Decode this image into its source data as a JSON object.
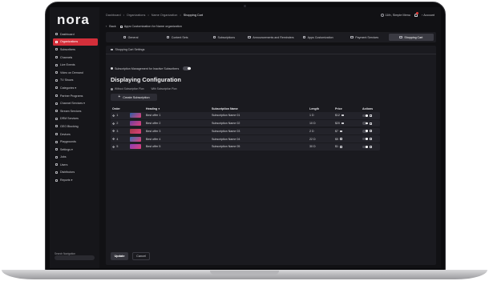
{
  "brand": {
    "logo_text": "nora"
  },
  "sidebar": {
    "items": [
      {
        "label": "Dashboard",
        "active": false
      },
      {
        "label": "Organizations",
        "active": true
      },
      {
        "label": "Subscribers",
        "active": false
      },
      {
        "label": "Channels",
        "active": false
      },
      {
        "label": "Live Events",
        "active": false
      },
      {
        "label": "Video on Demand",
        "active": false
      },
      {
        "label": "TV Shows",
        "active": false
      },
      {
        "label": "Categories ▾",
        "active": false
      },
      {
        "label": "Partner Programs",
        "active": false
      },
      {
        "label": "Channel Services ▾",
        "active": false
      },
      {
        "label": "Stream Services",
        "active": false
      },
      {
        "label": "DRM Services",
        "active": false
      },
      {
        "label": "GEO Blocking",
        "active": false
      },
      {
        "label": "Devices",
        "active": false
      },
      {
        "label": "Playgrounds",
        "active": false
      },
      {
        "label": "Settings ▾",
        "active": false
      },
      {
        "label": "Jobs",
        "active": false
      },
      {
        "label": "Users",
        "active": false
      },
      {
        "label": "Distributors",
        "active": false
      },
      {
        "label": "Reports ▾",
        "active": false
      }
    ],
    "search_label": "Search Navigation"
  },
  "breadcrumb": [
    "Dashboard",
    "Organizations",
    "Name Organization",
    "Shopping Cart"
  ],
  "topbar": {
    "time": "11th, Simple Menu",
    "account_label": "Account"
  },
  "back_row": {
    "back_label": "Back",
    "context_label": "Apps Customization for Name organization"
  },
  "tabs": [
    {
      "label": "General",
      "active": false
    },
    {
      "label": "Content Sets",
      "active": false
    },
    {
      "label": "Subscriptions",
      "active": false
    },
    {
      "label": "Announcements and Reminders",
      "active": false
    },
    {
      "label": "Apps Customization",
      "active": false
    },
    {
      "label": "Payment Services",
      "active": false
    },
    {
      "label": "Shopping Cart",
      "active": true
    }
  ],
  "panel": {
    "header": "Shopping Cart Settings",
    "toggle_label": "Subscription Management for Inactive Subscribers",
    "toggle_on": true,
    "section_title": "Displaying Configuration",
    "radio_options": [
      "Without Subscription Plan",
      "With Subscription Plan"
    ],
    "create_button": "Create Subscription"
  },
  "table": {
    "columns": {
      "order": "Order",
      "heading": "Heading",
      "name": "Subscription Name",
      "length": "Length",
      "price": "Price",
      "actions": "Actions"
    },
    "rows": [
      {
        "order": "1",
        "heading": "Best offer 1",
        "name": "Subscription Name 01",
        "length": "1 D",
        "price": "$12",
        "thumb": "#2b5fa8"
      },
      {
        "order": "2",
        "heading": "Best offer 2",
        "name": "Subscription Name 02",
        "length": "10 D",
        "price": "$20",
        "thumb": "#6b3fa0"
      },
      {
        "order": "3",
        "heading": "Best offer 3",
        "name": "Subscription Name 03",
        "length": "2 D",
        "price": "$7",
        "thumb": "#a03a4a"
      },
      {
        "order": "4",
        "heading": "Best offer 4",
        "name": "Subscription Name 04",
        "length": "22 D",
        "price": "$5",
        "thumb": "#3a6fb0"
      },
      {
        "order": "5",
        "heading": "Best offer 5",
        "name": "Subscription Name 05",
        "length": "30 D",
        "price": "$1",
        "thumb": "#8a3fb8"
      }
    ]
  },
  "footer": {
    "update_label": "Update",
    "cancel_label": "Cancel"
  },
  "colors": {
    "accent": "#d32f3a",
    "background": "#111114",
    "panel": "#1a1a1f"
  }
}
